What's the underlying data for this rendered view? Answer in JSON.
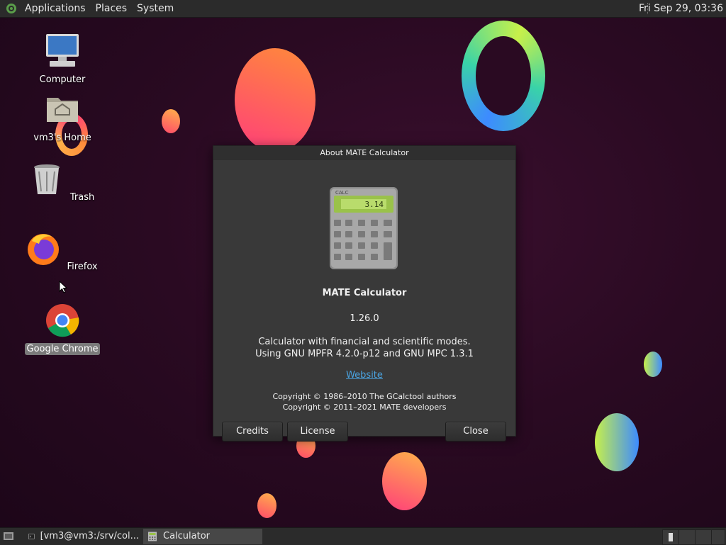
{
  "top_panel": {
    "menus": [
      "Applications",
      "Places",
      "System"
    ],
    "clock": "Fri Sep 29, 03:36"
  },
  "desktop": {
    "icons": [
      {
        "label": "Computer",
        "icon": "computer-icon"
      },
      {
        "label": "vm3's Home",
        "icon": "home-folder-icon"
      },
      {
        "label": "Trash",
        "icon": "trash-icon"
      },
      {
        "label": "Firefox",
        "icon": "firefox-icon"
      },
      {
        "label": "Google Chrome",
        "icon": "chrome-icon",
        "selected": true
      }
    ]
  },
  "dialog": {
    "title": "About MATE Calculator",
    "icon_display": "3.14",
    "icon_brand": "CALC",
    "app_name": "MATE Calculator",
    "version": "1.26.0",
    "description_line1": "Calculator with financial and scientific modes.",
    "description_line2": "Using GNU MPFR 4.2.0-p12 and GNU MPC 1.3.1",
    "website_label": "Website",
    "copyright_line1": "Copyright © 1986–2010 The GCalctool authors",
    "copyright_line2": "Copyright © 2011–2021 MATE developers",
    "buttons": {
      "credits": "Credits",
      "license": "License",
      "close": "Close"
    }
  },
  "bottom_panel": {
    "tasks": [
      {
        "label": "[vm3@vm3:/srv/col...",
        "icon": "terminal-icon"
      },
      {
        "label": "Calculator",
        "icon": "calculator-icon",
        "active": true
      }
    ]
  },
  "colors": {
    "panel_bg": "#2b2b2b",
    "dialog_bg": "#393939",
    "link": "#4aa3e0",
    "desktop_bg": "#2a0a22"
  }
}
